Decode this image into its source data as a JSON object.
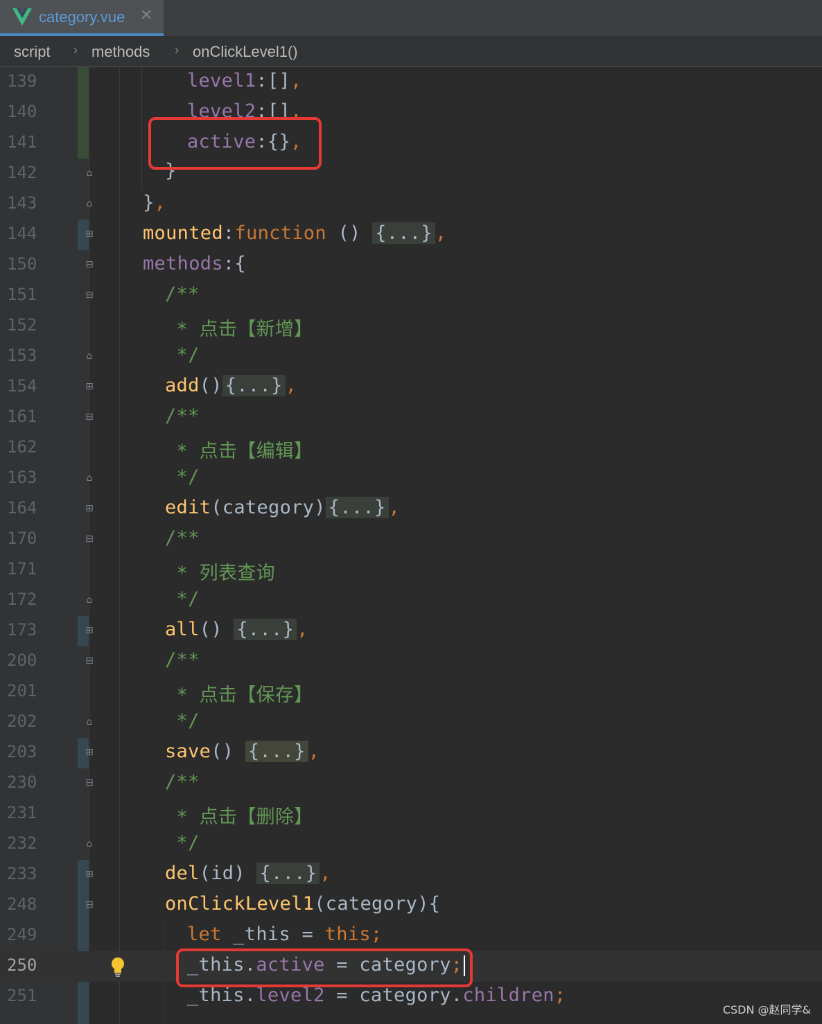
{
  "tab": {
    "title": "category.vue",
    "close_glyph": "✕",
    "icon": "vue-logo-icon"
  },
  "breadcrumb": {
    "items": [
      "script",
      "methods",
      "onClickLevel1()"
    ],
    "separator": "›"
  },
  "editor": {
    "line_numbers": [
      "139",
      "140",
      "141",
      "142",
      "143",
      "144",
      "150",
      "151",
      "152",
      "153",
      "154",
      "161",
      "162",
      "163",
      "164",
      "170",
      "171",
      "172",
      "173",
      "200",
      "201",
      "202",
      "203",
      "230",
      "231",
      "232",
      "233",
      "248",
      "249",
      "250",
      "251"
    ],
    "current_line": "250",
    "code": {
      "l139": {
        "a": "level1",
        "b": ":[]",
        "c": ","
      },
      "l140": {
        "a": "level2",
        "b": ":[]",
        "c": ","
      },
      "l141": {
        "a": "active",
        "b": ":{}",
        "c": ","
      },
      "l142": {
        "a": "}"
      },
      "l143": {
        "a": "}",
        "c": ","
      },
      "l144": {
        "a": "mounted",
        "b": ":",
        "k": "function",
        "d": " () ",
        "f": "{...}",
        "c": ","
      },
      "l150": {
        "a": "methods",
        "b": ":{"
      },
      "l151": {
        "a": "/**"
      },
      "l152": {
        "a": " * 点击【新增】"
      },
      "l153": {
        "a": " */"
      },
      "l154": {
        "a": "add",
        "b": "()",
        "f": "{...}",
        "c": ","
      },
      "l161": {
        "a": "/**"
      },
      "l162": {
        "a": " * 点击【编辑】"
      },
      "l163": {
        "a": " */"
      },
      "l164": {
        "a": "edit",
        "b": "(category)",
        "f": "{...}",
        "c": ","
      },
      "l170": {
        "a": "/**"
      },
      "l171": {
        "a": " * 列表查询"
      },
      "l172": {
        "a": " */"
      },
      "l173": {
        "a": "all",
        "b": "() ",
        "f": "{...}",
        "c": ","
      },
      "l200": {
        "a": "/**"
      },
      "l201": {
        "a": " * 点击【保存】"
      },
      "l202": {
        "a": " */"
      },
      "l203": {
        "a": "save",
        "b": "() ",
        "f": "{...}",
        "c": ","
      },
      "l230": {
        "a": "/**"
      },
      "l231": {
        "a": " * 点击【删除】"
      },
      "l232": {
        "a": " */"
      },
      "l233": {
        "a": "del",
        "b": "(id) ",
        "f": "{...}",
        "c": ","
      },
      "l248": {
        "a": "onClickLevel1",
        "b": "(category){"
      },
      "l249": {
        "k": "let",
        "b": " _this = ",
        "k2": "this",
        "c": ";"
      },
      "l250": {
        "a": "_this.",
        "p": "active",
        "b": " = category",
        "c": ";"
      },
      "l251": {
        "a": "_this.",
        "p": "level2",
        "b": " = category.",
        "p2": "children",
        "c": ";"
      }
    }
  },
  "colors": {
    "background": "#2b2b2b",
    "keyword": "#cc7832",
    "function": "#ffc66d",
    "property": "#9876aa",
    "comment": "#629755",
    "highlight_box": "#e53935"
  },
  "watermark": "CSDN @赵同学&"
}
